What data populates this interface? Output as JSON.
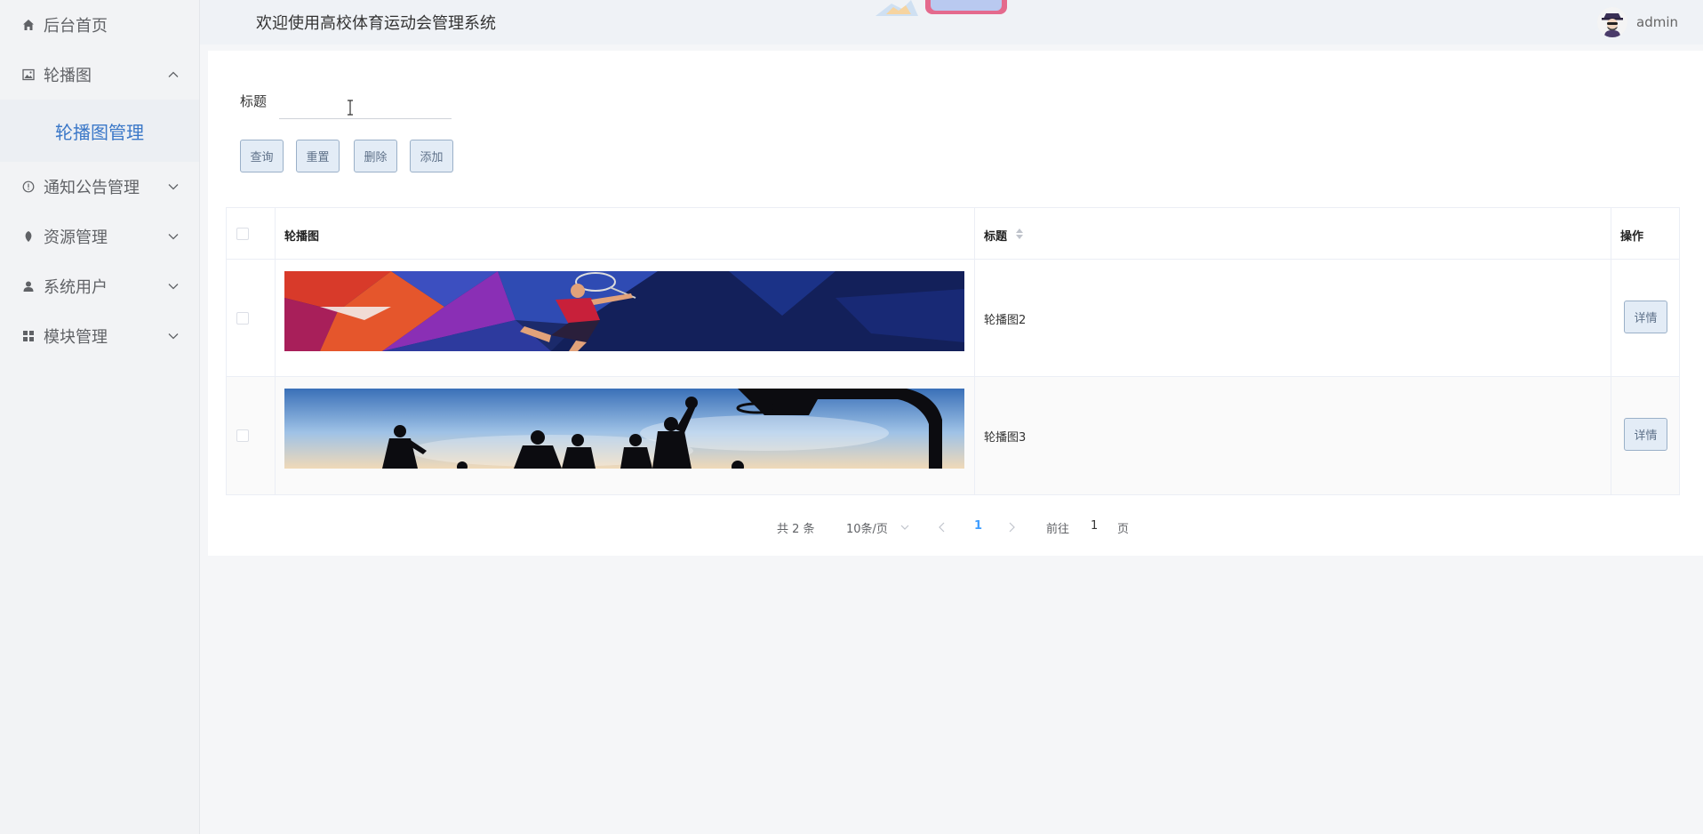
{
  "sidebar": {
    "items": [
      {
        "label": "后台首页",
        "icon": "home-icon"
      },
      {
        "label": "轮播图",
        "icon": "image-icon",
        "expanded": true,
        "children": [
          {
            "label": "轮播图管理",
            "active": true
          }
        ]
      },
      {
        "label": "通知公告管理",
        "icon": "info-icon"
      },
      {
        "label": "资源管理",
        "icon": "leaf-icon"
      },
      {
        "label": "系统用户",
        "icon": "user-icon"
      },
      {
        "label": "模块管理",
        "icon": "grid-icon"
      }
    ],
    "active_color": "#3b78c8"
  },
  "header": {
    "title": "欢迎使用高校体育运动会管理系统",
    "username": "admin"
  },
  "search": {
    "label": "标题",
    "value": ""
  },
  "toolbar": {
    "query_label": "查询",
    "reset_label": "重置",
    "delete_label": "删除",
    "add_label": "添加"
  },
  "table": {
    "columns": {
      "image": "轮播图",
      "title": "标题",
      "actions": "操作"
    },
    "rows": [
      {
        "title": "轮播图2",
        "image": "badminton-banner",
        "action": "详情"
      },
      {
        "title": "轮播图3",
        "image": "basketball-banner",
        "action": "详情"
      }
    ]
  },
  "pagination": {
    "total": "共 2 条",
    "page_size": "10条/页",
    "current": "1",
    "goto_label": "前往",
    "goto_value": "1",
    "page_suffix": "页"
  },
  "colors": {
    "button_bg": "#e3ecf6",
    "button_border": "#9ab0c8",
    "link_blue": "#409eff"
  }
}
